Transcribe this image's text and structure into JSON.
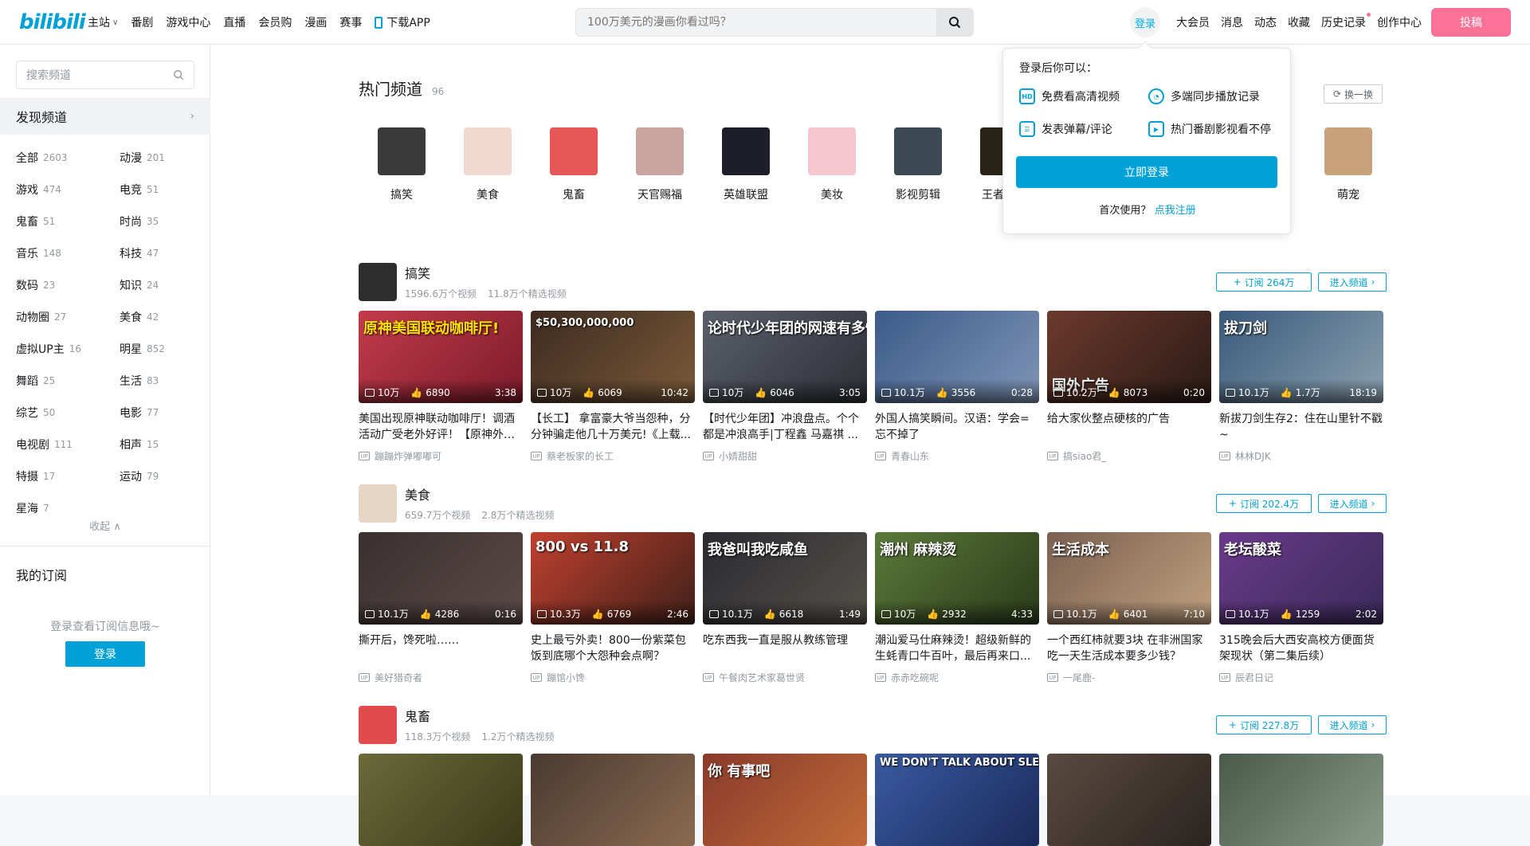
{
  "header": {
    "logo": "bilibili",
    "nav": [
      "主站",
      "番剧",
      "游戏中心",
      "直播",
      "会员购",
      "漫画",
      "赛事"
    ],
    "download": "下载APP",
    "search_placeholder": "100万美元的漫画你看过吗？",
    "login": "登录",
    "right": [
      "大会员",
      "消息",
      "动态",
      "收藏",
      "历史记录",
      "创作中心"
    ],
    "upload": "投稿"
  },
  "sidebar": {
    "search_placeholder": "搜索频道",
    "discover": "发现频道",
    "categories": [
      {
        "name": "全部",
        "count": "2603"
      },
      {
        "name": "动漫",
        "count": "201"
      },
      {
        "name": "游戏",
        "count": "474"
      },
      {
        "name": "电竞",
        "count": "51"
      },
      {
        "name": "鬼畜",
        "count": "51"
      },
      {
        "name": "时尚",
        "count": "35"
      },
      {
        "name": "音乐",
        "count": "148"
      },
      {
        "name": "科技",
        "count": "47"
      },
      {
        "name": "数码",
        "count": "23"
      },
      {
        "name": "知识",
        "count": "24"
      },
      {
        "name": "动物圈",
        "count": "27"
      },
      {
        "name": "美食",
        "count": "42"
      },
      {
        "name": "虚拟UP主",
        "count": "16"
      },
      {
        "name": "明星",
        "count": "852"
      },
      {
        "name": "舞蹈",
        "count": "25"
      },
      {
        "name": "生活",
        "count": "83"
      },
      {
        "name": "综艺",
        "count": "50"
      },
      {
        "name": "电影",
        "count": "77"
      },
      {
        "name": "电视剧",
        "count": "111"
      },
      {
        "name": "相声",
        "count": "15"
      },
      {
        "name": "特摄",
        "count": "17"
      },
      {
        "name": "运动",
        "count": "79"
      },
      {
        "name": "星海",
        "count": "7"
      }
    ],
    "collapse": "收起",
    "my_sub": "我的订阅",
    "sub_hint": "登录查看订阅信息哦~",
    "sub_login": "登录"
  },
  "hot": {
    "title": "热门频道",
    "count": "96",
    "refresh": "换一换",
    "channels": [
      "搞笑",
      "美食",
      "鬼畜",
      "天官赐福",
      "英雄联盟",
      "美妆",
      "影视剪辑",
      "王者荣耀",
      "",
      "",
      "",
      "萌宠"
    ]
  },
  "popup": {
    "heading": "登录后你可以：",
    "perks": [
      "免费看高清视频",
      "多端同步播放记录",
      "发表弹幕/评论",
      "热门番剧影视看不停"
    ],
    "button": "立即登录",
    "first_use": "首次使用？",
    "register": "点我注册"
  },
  "sections": [
    {
      "name": "搞笑",
      "videos_total": "1596.6万个视频",
      "featured": "11.8万个精选视频",
      "subscribe": "订阅 264万",
      "enter": "进入频道",
      "cards": [
        {
          "play": "10万",
          "like": "6890",
          "dur": "3:38",
          "title": "美国出现原神联动咖啡厅！调酒活动广受老外好评！【原神外国...",
          "up": "蹦蹦炸弹嘟嘟可",
          "overlay": "原神美国联动咖啡厅!"
        },
        {
          "play": "10万",
          "like": "6069",
          "dur": "10:42",
          "title": "【长工】 拿富豪大爷当怨种，分分钟骗走他几十万美元!《上载...",
          "up": "蔡老板家的长工",
          "overlay": "$50,300,000,000"
        },
        {
          "play": "10万",
          "like": "6046",
          "dur": "3:05",
          "title": "【时代少年团】冲浪盘点。个个都是冲浪高手|丁程鑫 马嘉祺 ...",
          "up": "小婧甜甜",
          "overlay": "论时代少年团的网速有多快"
        },
        {
          "play": "10.1万",
          "like": "3556",
          "dur": "0:28",
          "title": "外国人搞笑瞬间。汉语：学会=忘不掉了",
          "up": "青春山东",
          "overlay": ""
        },
        {
          "play": "10.2万",
          "like": "8073",
          "dur": "0:20",
          "title": "给大家伙整点硬核的广告",
          "up": "搞siao君_",
          "overlay": "国外广告"
        },
        {
          "play": "10.1万",
          "like": "1.7万",
          "dur": "18:19",
          "title": "新拔刀剑生存2：住在山里针不戳~",
          "up": "林林DJK",
          "overlay": "拔刀剑"
        }
      ]
    },
    {
      "name": "美食",
      "videos_total": "659.7万个视频",
      "featured": "2.8万个精选视频",
      "subscribe": "订阅 202.4万",
      "enter": "进入频道",
      "cards": [
        {
          "play": "10.1万",
          "like": "4286",
          "dur": "0:16",
          "title": "撕开后，馋死啦……",
          "up": "美好猎奇者",
          "overlay": ""
        },
        {
          "play": "10.3万",
          "like": "6769",
          "dur": "2:46",
          "title": "史上最亏外卖！800一份紫菜包饭到底哪个大怨种会点啊？",
          "up": "蹦馆小馋",
          "overlay": "800 vs 11.8"
        },
        {
          "play": "10.1万",
          "like": "6618",
          "dur": "1:49",
          "title": "吃东西我一直是服从教练管理",
          "up": "午餐肉艺术家葛世贤",
          "overlay": "我爸叫我吃咸鱼"
        },
        {
          "play": "10万",
          "like": "2932",
          "dur": "4:33",
          "title": "潮汕爱马仕麻辣烫！超级新鲜的生蚝青口牛百叶，最后再来口...",
          "up": "赤赤吃碗呢",
          "overlay": "潮州 麻辣烫"
        },
        {
          "play": "10.1万",
          "like": "6401",
          "dur": "7:10",
          "title": "一个西红柿就要3块 在非洲国家吃一天生活成本要多少钱？",
          "up": "一尾鹿-",
          "overlay": "生活成本"
        },
        {
          "play": "10.1万",
          "like": "1259",
          "dur": "2:02",
          "title": "315晚会后大西安高校方便面货架现状（第二集后续）",
          "up": "辰君日记",
          "overlay": "老坛酸菜"
        }
      ]
    },
    {
      "name": "鬼畜",
      "videos_total": "118.3万个视频",
      "featured": "1.2万个精选视频",
      "subscribe": "订阅 227.8万",
      "enter": "进入频道",
      "cards": [
        {
          "overlay": ""
        },
        {
          "overlay": ""
        },
        {
          "overlay": "你 有事吧"
        },
        {
          "overlay": "WE DON'T TALK ABOUT SLEEPY JOE"
        },
        {
          "overlay": ""
        },
        {
          "overlay": ""
        }
      ]
    }
  ],
  "colors": {
    "accent": "#00a1d6",
    "pink": "#fb7299",
    "text_gray": "#9499a0"
  }
}
